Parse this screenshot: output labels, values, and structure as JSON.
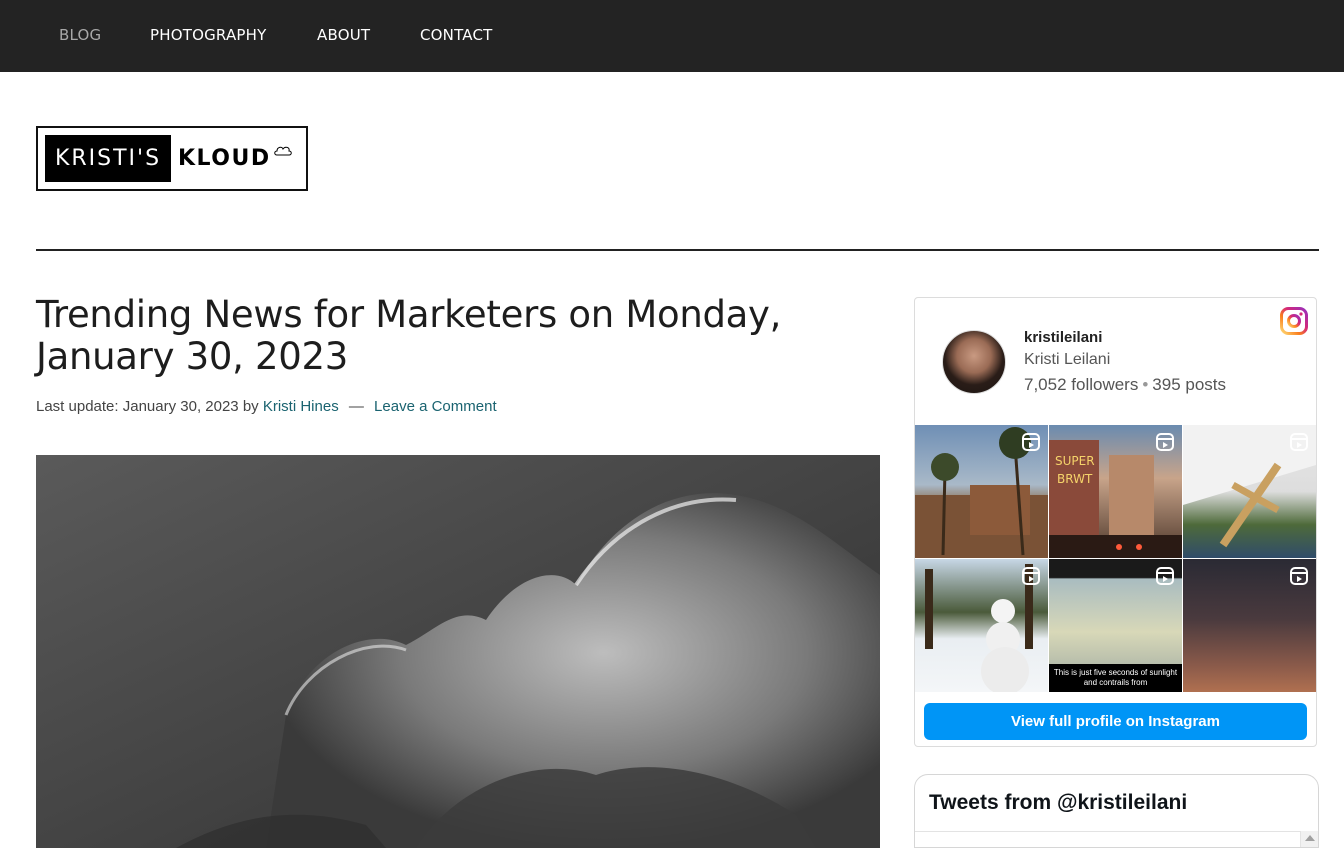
{
  "nav": {
    "items": [
      {
        "label": "BLOG",
        "active": true
      },
      {
        "label": "PHOTOGRAPHY",
        "active": false
      },
      {
        "label": "ABOUT",
        "active": false
      },
      {
        "label": "CONTACT",
        "active": false
      }
    ]
  },
  "logo": {
    "word1": "KRISTI'S",
    "word2": "KLOUD"
  },
  "post": {
    "title": "Trending News for Marketers on Monday, January 30, 2023",
    "meta_prefix": "Last update: January 30, 2023 by",
    "author": "Kristi Hines",
    "dash": "—",
    "comment_link": "Leave a Comment"
  },
  "instagram": {
    "username": "kristileilani",
    "full_name": "Kristi Leilani",
    "followers": "7,052 followers",
    "posts": "395 posts",
    "tiles": [
      {
        "subject": "palm-trees-building",
        "reel": true
      },
      {
        "subject": "super-burrito-street",
        "reel": true
      },
      {
        "subject": "wooden-cross-note",
        "reel": true
      },
      {
        "subject": "snowman-forest",
        "reel": true
      },
      {
        "subject": "sky-contrails",
        "reel": true,
        "caption": "This is just five seconds of sunlight and contrails from"
      },
      {
        "subject": "sunset-sky",
        "reel": true
      }
    ],
    "button_label": "View full profile on Instagram"
  },
  "tweets": {
    "title": "Tweets from @kristileilani"
  },
  "colors": {
    "nav_bg": "#232323",
    "link": "#1a6370",
    "instagram_button": "#0095f6"
  }
}
